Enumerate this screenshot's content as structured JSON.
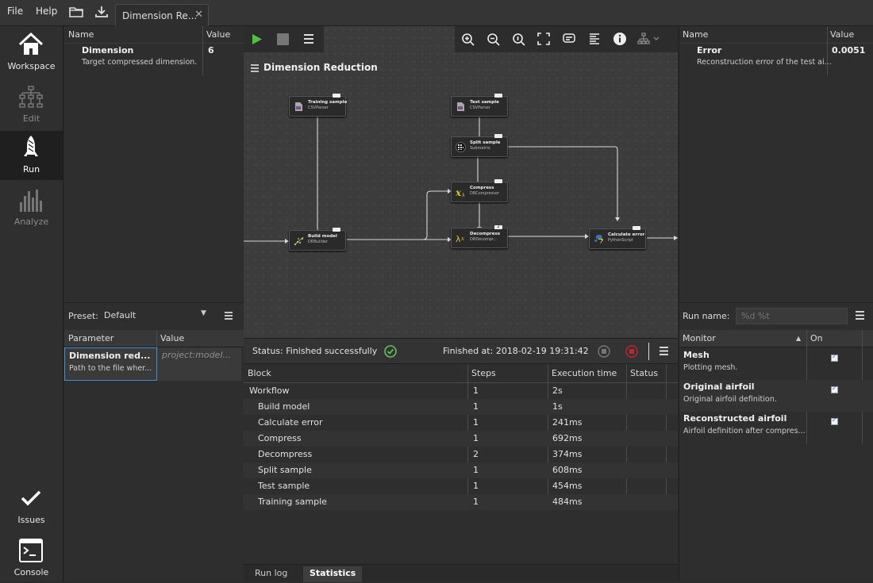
{
  "menu": {
    "file": "File",
    "help": "Help"
  },
  "tab": {
    "title": "Dimension Re...",
    "close": "✕"
  },
  "sidebar": [
    {
      "label": "Workspace",
      "icon": "house-icon"
    },
    {
      "label": "Edit",
      "icon": "workflow-icon"
    },
    {
      "label": "Run",
      "icon": "rocket-icon"
    },
    {
      "label": "Analyze",
      "icon": "bar-chart-icon"
    },
    {
      "label": "Issues",
      "icon": "checkmark-icon"
    },
    {
      "label": "Console",
      "icon": "terminal-icon"
    }
  ],
  "options_table": {
    "headers": {
      "name": "Name",
      "value": "Value"
    },
    "row": {
      "name": "Dimension",
      "description": "Target compressed dimension.",
      "value": "6"
    }
  },
  "preset": {
    "label": "Preset:",
    "value": "Default",
    "headers": {
      "param": "Parameter",
      "value": "Value"
    },
    "row": {
      "name": "Dimension red...",
      "description": "Path to the file wher...",
      "value": "project:model..."
    }
  },
  "workflow": {
    "title": "Dimension Reduction",
    "nodes": [
      {
        "title": "Training sample",
        "sub": "CSVParser"
      },
      {
        "title": "Test sample",
        "sub": "CSVParser"
      },
      {
        "title": "Split sample",
        "sub": "Submatrix"
      },
      {
        "title": "Compress",
        "sub": "DRCompressor"
      },
      {
        "title": "Build model",
        "sub": "DRBuilder"
      },
      {
        "title": "Decompress",
        "sub": "DRDecompr..."
      },
      {
        "title": "Calculate error",
        "sub": "PythonScript"
      }
    ],
    "port_counts": {
      "decompress": "2"
    }
  },
  "results_table": {
    "headers": {
      "name": "Name",
      "value": "Value"
    },
    "row": {
      "name": "Error",
      "description": "Reconstruction error of the test ai...",
      "value": "0.0051"
    }
  },
  "status": {
    "text": "Status: Finished successfully",
    "finished": "Finished at: 2018-02-19 19:31:42"
  },
  "stats": {
    "headers": {
      "block": "Block",
      "steps": "Steps",
      "time": "Execution time",
      "status": "Status"
    },
    "rows": [
      {
        "block": "Workflow",
        "steps": "1",
        "time": "2s"
      },
      {
        "block": "Build model",
        "steps": "1",
        "time": "1s"
      },
      {
        "block": "Calculate error",
        "steps": "1",
        "time": "241ms"
      },
      {
        "block": "Compress",
        "steps": "1",
        "time": "692ms"
      },
      {
        "block": "Decompress",
        "steps": "2",
        "time": "374ms"
      },
      {
        "block": "Split sample",
        "steps": "1",
        "time": "608ms"
      },
      {
        "block": "Test sample",
        "steps": "1",
        "time": "454ms"
      },
      {
        "block": "Training sample",
        "steps": "1",
        "time": "484ms"
      }
    ]
  },
  "bottom_tabs": {
    "run_log": "Run log",
    "statistics": "Statistics"
  },
  "run": {
    "label": "Run name:",
    "placeholder": "%d %t"
  },
  "monitor": {
    "headers": {
      "monitor": "Monitor",
      "on": "On"
    },
    "rows": [
      {
        "name": "Mesh",
        "description": "Plotting mesh.",
        "checked": true
      },
      {
        "name": "Original airfoil",
        "description": "Original airfoil definition.",
        "checked": true
      },
      {
        "name": "Reconstructed airfoil",
        "description": "Airfoil definition after compres...",
        "checked": true
      }
    ]
  },
  "colors": {
    "run_green": "#4cc43a",
    "success_green": "#5cc45a",
    "stop_red": "#c0282d",
    "selection_blue": "#3d8fd6"
  }
}
